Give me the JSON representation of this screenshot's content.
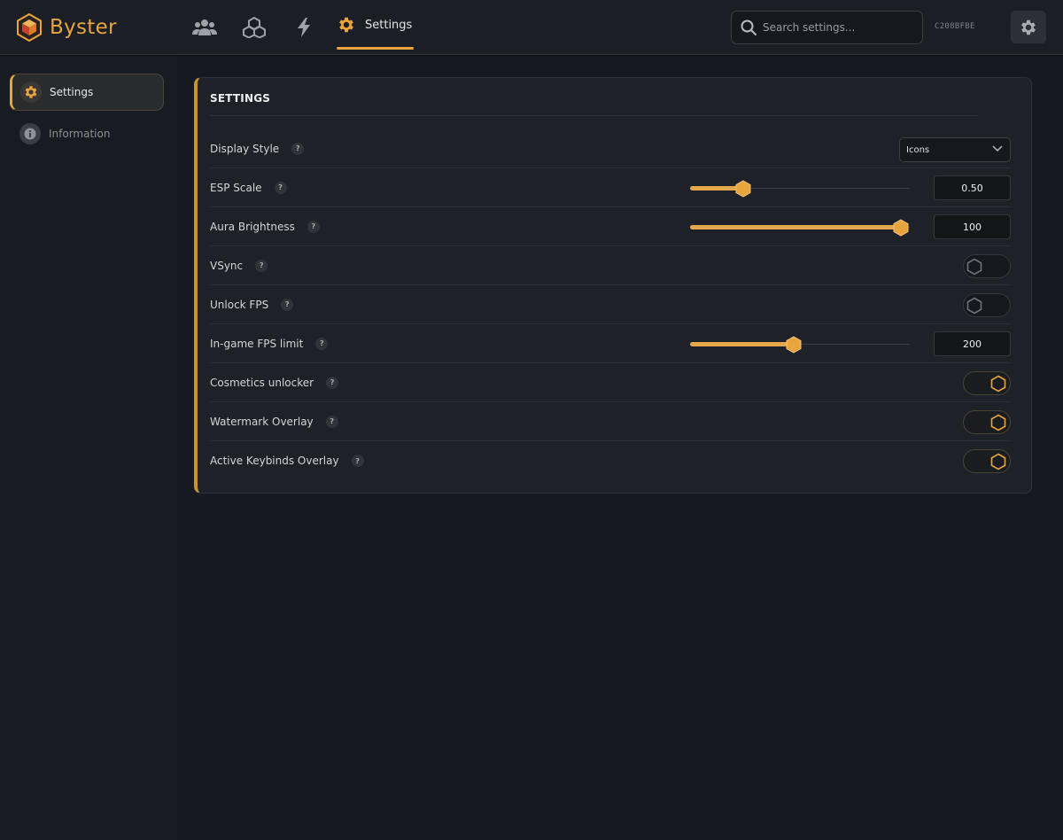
{
  "app": {
    "name": "Byster",
    "hwid": "C208BFBE"
  },
  "topnav": {
    "items": [
      {
        "icon": "users-icon"
      },
      {
        "icon": "cubes-icon"
      },
      {
        "icon": "bolt-icon"
      },
      {
        "icon": "gear-icon",
        "label": "Settings",
        "active": true
      }
    ],
    "search_placeholder": "Search settings..."
  },
  "sidebar": {
    "items": [
      {
        "label": "Settings",
        "icon": "gear-icon",
        "active": true
      },
      {
        "label": "Information",
        "icon": "info-icon",
        "active": false
      }
    ]
  },
  "panel": {
    "title": "SETTINGS",
    "help_glyph": "?",
    "rows": [
      {
        "label": "Display Style",
        "control": "select",
        "value": "Icons"
      },
      {
        "label": "ESP Scale",
        "control": "slider",
        "value": "0.50",
        "fraction": 0.24
      },
      {
        "label": "Aura Brightness",
        "control": "slider",
        "value": "100",
        "fraction": 0.96
      },
      {
        "label": "VSync",
        "control": "toggle",
        "on": false
      },
      {
        "label": "Unlock FPS",
        "control": "toggle",
        "on": false
      },
      {
        "label": "In-game FPS limit",
        "control": "slider",
        "value": "200",
        "fraction": 0.47
      },
      {
        "label": "Cosmetics unlocker",
        "control": "toggle",
        "on": true
      },
      {
        "label": "Watermark Overlay",
        "control": "toggle",
        "on": true
      },
      {
        "label": "Active Keybinds Overlay",
        "control": "toggle",
        "on": true
      }
    ]
  },
  "colors": {
    "accent": "#e8a53e",
    "background": "#16191f",
    "panel": "#1e2128"
  }
}
